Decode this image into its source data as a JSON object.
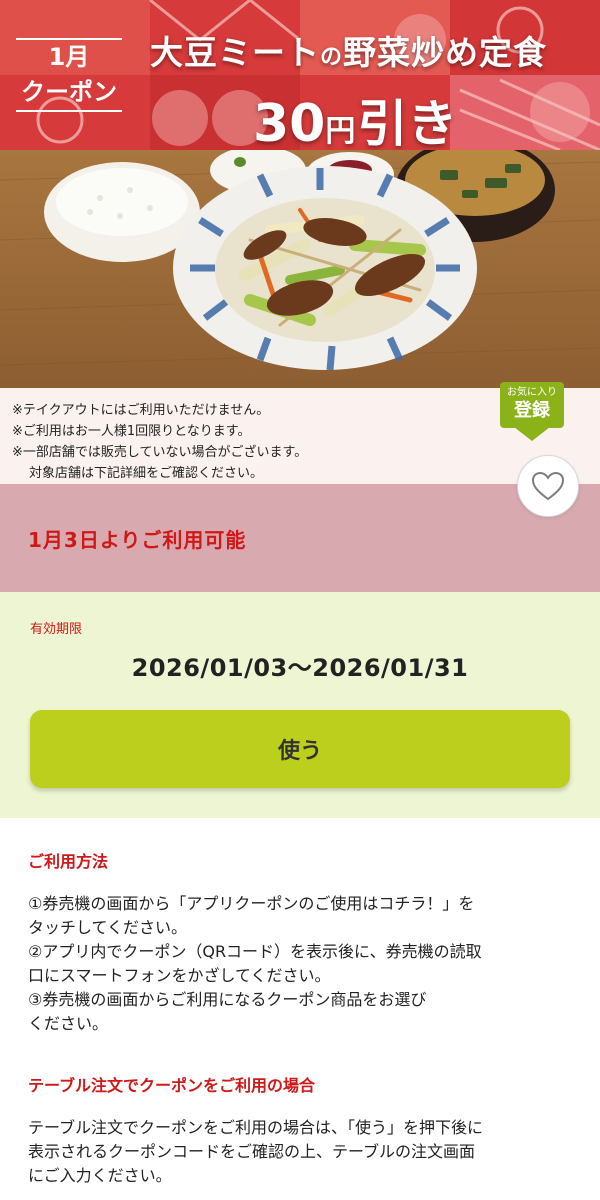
{
  "banner": {
    "month": "1月",
    "coupon_word": "クーポン",
    "title_part1": "大豆ミート",
    "title_particle": "の",
    "title_part2": "野菜炒め定食",
    "discount_number": "30",
    "discount_yen": "円",
    "discount_suffix": "引き",
    "background_color": "#d63a3a"
  },
  "notice": {
    "line1": "※テイクアウトにはご利用いただけません。",
    "line2": "※ご利用はお一人様1回限りとなります。",
    "line3": "※一部店舗では販売していない場合がございます。",
    "line4": "対象店舗は下記詳細をご確認ください。"
  },
  "favorite_badge": {
    "small_label": "お気に入り",
    "big_label": "登録",
    "color": "#8cb21a"
  },
  "heart_button": {
    "icon": "heart-outline-icon"
  },
  "availability": {
    "text": "1月3日よりご利用可能",
    "background_color": "#d8aab0",
    "text_color": "#d01818"
  },
  "validity": {
    "label": "有効期限",
    "dates": "2026/01/03～2026/01/31",
    "background_color": "#eef5d2"
  },
  "use_button": {
    "label": "使う",
    "color": "#bccf1c"
  },
  "how_to": {
    "title": "ご利用方法",
    "steps": [
      "①券売機の画面から「アプリクーポンのご使用はコチラ！」を",
      "タッチしてください。",
      "②アプリ内でクーポン（QRコード）を表示後に、券売機の読取",
      "口にスマートフォンをかざしてください。",
      "③券売機の画面からご利用になるクーポン商品をお選び",
      "ください。"
    ]
  },
  "table_order": {
    "title": "テーブル注文でクーポンをご利用の場合",
    "lines": [
      "テーブル注文でクーポンをご利用の場合は、「使う」を押下後に",
      "表示されるクーポンコードをご確認の上、テーブルの注文画面",
      "にご入力ください。"
    ]
  }
}
